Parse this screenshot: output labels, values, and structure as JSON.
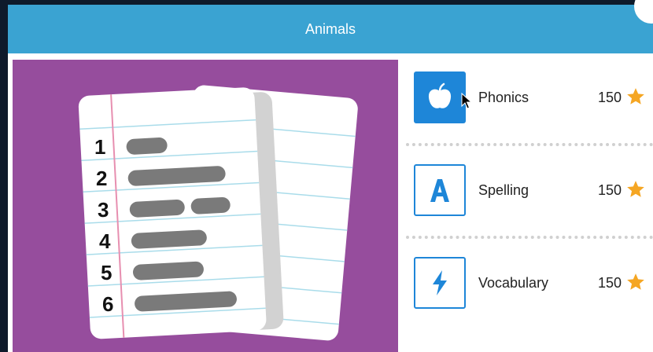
{
  "header": {
    "title": "Animals"
  },
  "activities": [
    {
      "label": "Phonics",
      "points": "150",
      "icon": "apple-icon",
      "style": "filled"
    },
    {
      "label": "Spelling",
      "points": "150",
      "icon": "letter-a-icon",
      "style": "outline"
    },
    {
      "label": "Vocabulary",
      "points": "150",
      "icon": "lightning-icon",
      "style": "outline"
    }
  ],
  "illustration": {
    "icon": "list-papers-icon",
    "numbers": [
      "1",
      "2",
      "3",
      "4",
      "5",
      "6"
    ]
  },
  "colors": {
    "header": "#3aa3d2",
    "illustration_bg": "#964d9d",
    "tile_blue": "#1e86d8",
    "star": "#f5a623"
  }
}
